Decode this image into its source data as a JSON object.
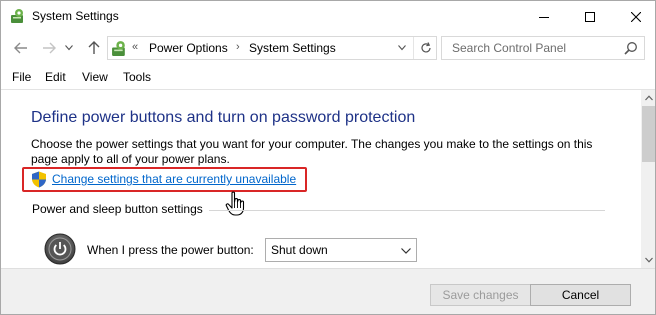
{
  "window": {
    "title": "System Settings"
  },
  "nav": {
    "back_icon": "arrow-left-icon",
    "forward_icon": "arrow-right-icon",
    "recent_icon": "chevron-down-icon",
    "up_icon": "arrow-up-icon"
  },
  "address": {
    "overflow": "«",
    "breadcrumbs": [
      "Power Options",
      "System Settings"
    ],
    "separator": "›"
  },
  "search": {
    "placeholder": "Search Control Panel"
  },
  "menu": {
    "items": [
      "File",
      "Edit",
      "View",
      "Tools"
    ]
  },
  "content": {
    "heading": "Define power buttons and turn on password protection",
    "description": "Choose the power settings that you want for your computer. The changes you make to the settings on this page apply to all of your power plans.",
    "change_link": "Change settings that are currently unavailable",
    "section_label": "Power and sleep button settings",
    "power_button_label": "When I press the power button:",
    "power_button_value": "Shut down"
  },
  "footer": {
    "save_label": "Save changes",
    "cancel_label": "Cancel"
  },
  "colors": {
    "heading": "#1e3287",
    "link": "#0066cc",
    "highlight": "#d92626",
    "footer_bg": "#f0f0f0"
  }
}
